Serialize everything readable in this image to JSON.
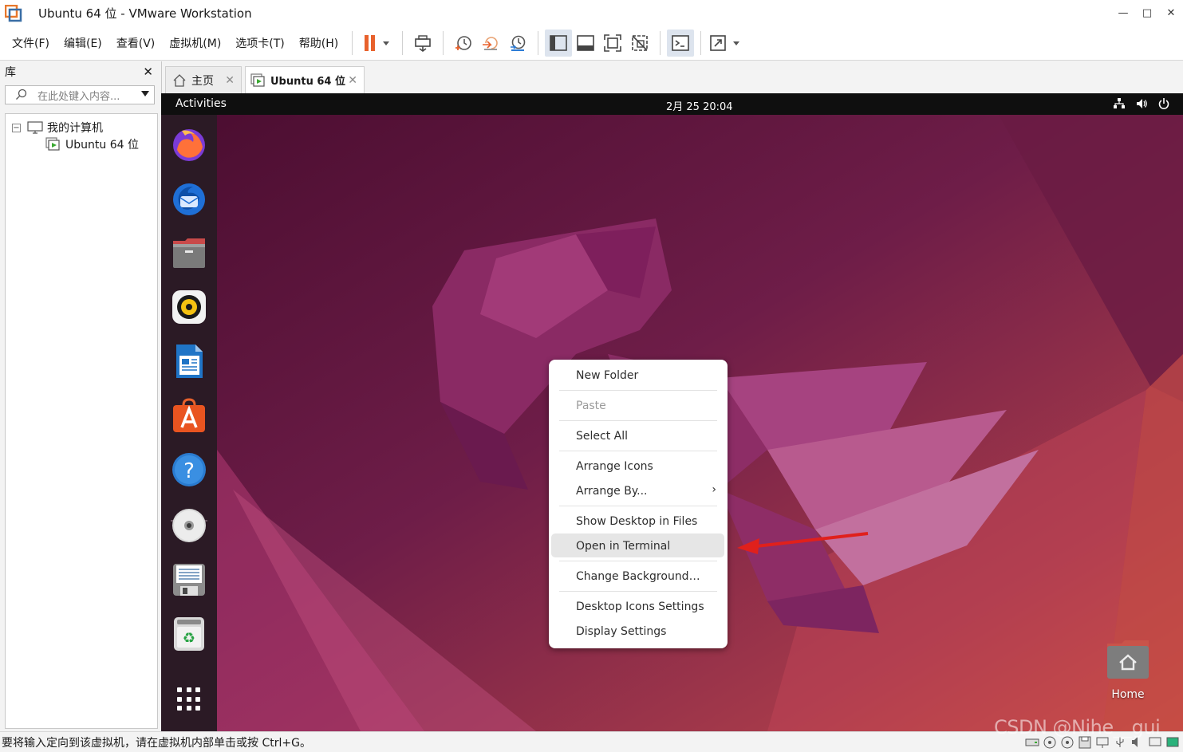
{
  "window": {
    "title": "Ubuntu 64 位 - VMware Workstation",
    "controls": [
      "minimize",
      "maximize",
      "close"
    ]
  },
  "menubar": {
    "items": [
      {
        "label": "文件(F)"
      },
      {
        "label": "编辑(E)"
      },
      {
        "label": "查看(V)"
      },
      {
        "label": "虚拟机(M)"
      },
      {
        "label": "选项卡(T)"
      },
      {
        "label": "帮助(H)"
      }
    ],
    "toolbar_icons": [
      "pause-icon",
      "send-keys-icon",
      "snapshot-take-icon",
      "snapshot-revert-icon",
      "snapshot-manager-icon",
      "library-view-icon",
      "thumbnail-bar-icon",
      "full-screen-icon",
      "unity-icon",
      "console-view-icon",
      "stretch-guest-icon"
    ],
    "accent_color": "#e8612c"
  },
  "library": {
    "title": "库",
    "search_placeholder": "在此处键入内容...",
    "tree": {
      "root": "我的计算机",
      "children": [
        "Ubuntu 64 位"
      ]
    }
  },
  "tabs": [
    {
      "label": "主页",
      "icon": "home-icon",
      "active": false
    },
    {
      "label": "Ubuntu 64 位",
      "icon": "vm-icon",
      "active": true
    }
  ],
  "ubuntu": {
    "activities": "Activities",
    "clock": "2月 25  20:04",
    "tray_icons": [
      "network-icon",
      "volume-icon",
      "power-icon"
    ],
    "dock": [
      "firefox-icon",
      "thunderbird-icon",
      "files-icon",
      "rhythmbox-icon",
      "libreoffice-writer-icon",
      "app-center-icon",
      "help-icon",
      "cd-drive-icon",
      "floppy-drive-icon",
      "trash-icon",
      "show-apps-icon"
    ],
    "context_menu": {
      "items": [
        {
          "label": "New Folder",
          "enabled": true
        },
        {
          "label": "Paste",
          "enabled": false
        },
        {
          "label": "Select All",
          "enabled": true
        },
        {
          "label": "Arrange Icons",
          "enabled": true
        },
        {
          "label": "Arrange By...",
          "enabled": true,
          "submenu": true
        },
        {
          "label": "Show Desktop in Files",
          "enabled": true
        },
        {
          "label": "Open in Terminal",
          "enabled": true,
          "highlighted": true
        },
        {
          "label": "Change Background…",
          "enabled": true
        },
        {
          "label": "Desktop Icons Settings",
          "enabled": true
        },
        {
          "label": "Display Settings",
          "enabled": true
        }
      ],
      "arrow_color": "#e0201c"
    },
    "desktop_icon": {
      "label": "Home"
    }
  },
  "statusbar": {
    "message": "要将输入定向到该虚拟机，请在虚拟机内部单击或按 Ctrl+G。"
  },
  "watermark": "CSDN @Nihe__gui"
}
